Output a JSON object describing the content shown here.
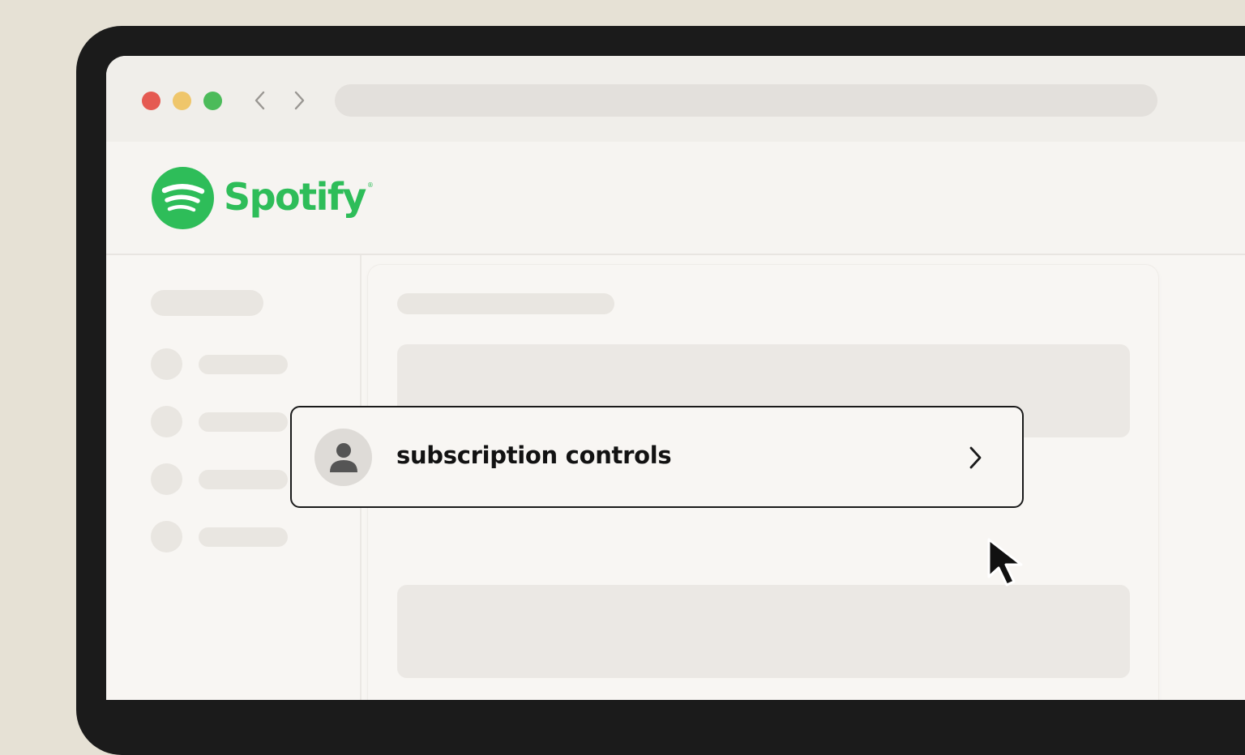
{
  "browser": {
    "window_controls": [
      "close",
      "minimize",
      "maximize"
    ],
    "navigation": {
      "back_icon": "chevron-left-icon",
      "forward_icon": "chevron-right-icon"
    },
    "address_value": ""
  },
  "brand": {
    "name": "Spotify",
    "mark": "®",
    "color": "#2ebd59"
  },
  "account_menu": {
    "item": {
      "label": "subscription controls",
      "icon": "user-icon",
      "trailing_icon": "chevron-right-icon"
    }
  },
  "colors": {
    "frame": "#1b1b1b",
    "background": "#e6e1d5",
    "surface": "#f8f6f3",
    "placeholder": "#e9e6e1",
    "close": "#e55a52",
    "minimize": "#efc66b",
    "maximize": "#4cbb5a"
  },
  "cursor": "arrow-cursor-icon"
}
